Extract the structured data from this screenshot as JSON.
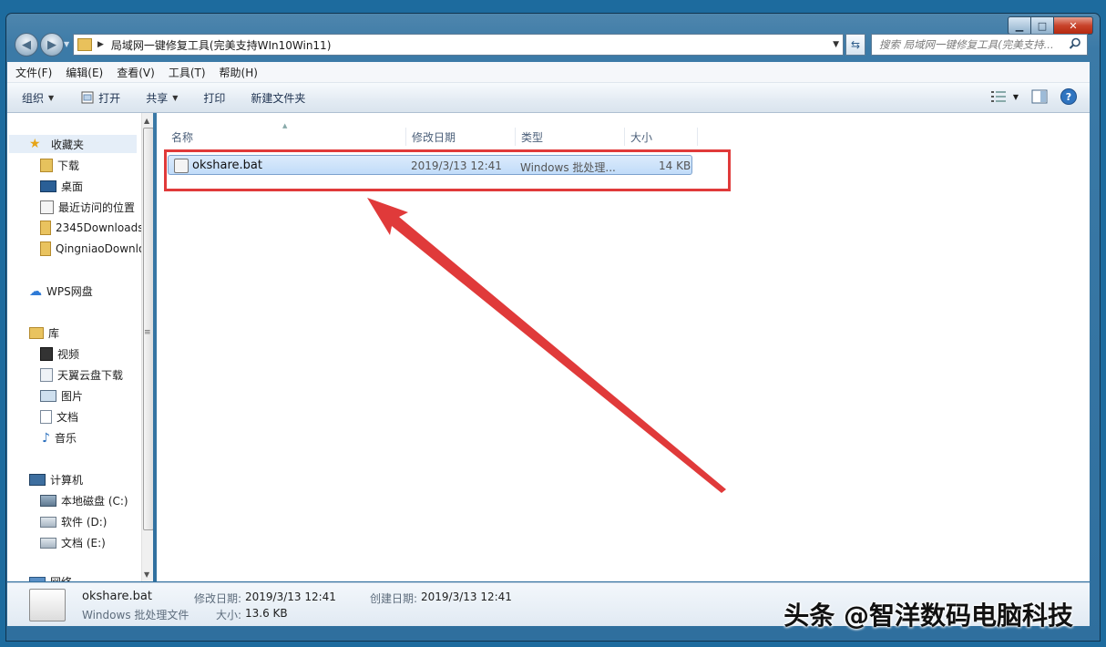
{
  "address": {
    "path": "局域网一键修复工具(完美支持WIn10Win11)"
  },
  "search": {
    "placeholder": "搜索 局域网一键修复工具(完美支持..."
  },
  "menu": [
    "文件(F)",
    "编辑(E)",
    "查看(V)",
    "工具(T)",
    "帮助(H)"
  ],
  "toolbar": {
    "organize": "组织",
    "open": "打开",
    "share": "共享",
    "print": "打印",
    "new_folder": "新建文件夹"
  },
  "nav": {
    "favorites": "收藏夹",
    "downloads": "下载",
    "desktop": "桌面",
    "recent": "最近访问的位置",
    "folder1": "2345Downloads",
    "folder2": "QingniaoDownloads",
    "wps": "WPS网盘",
    "libraries": "库",
    "videos": "视频",
    "tianyi": "天翼云盘下载",
    "pictures": "图片",
    "documents": "文档",
    "music": "音乐",
    "computer": "计算机",
    "drive_c": "本地磁盘 (C:)",
    "drive_d": "软件 (D:)",
    "drive_e": "文档 (E:)",
    "network": "网络"
  },
  "columns": {
    "name": "名称",
    "modified": "修改日期",
    "type": "类型",
    "size": "大小"
  },
  "file": {
    "name": "okshare.bat",
    "modified": "2019/3/13 12:41",
    "type": "Windows 批处理...",
    "size": "14 KB"
  },
  "details": {
    "filename": "okshare.bat",
    "filetype": "Windows 批处理文件",
    "modified_label": "修改日期:",
    "modified_value": "2019/3/13 12:41",
    "created_label": "创建日期:",
    "created_value": "2019/3/13 12:41",
    "size_label": "大小:",
    "size_value": "13.6 KB"
  },
  "watermark": "头条 @智洋数码电脑科技",
  "colors": {
    "highlight_box": "#e03a3a",
    "selection": "#c1dcf9"
  }
}
